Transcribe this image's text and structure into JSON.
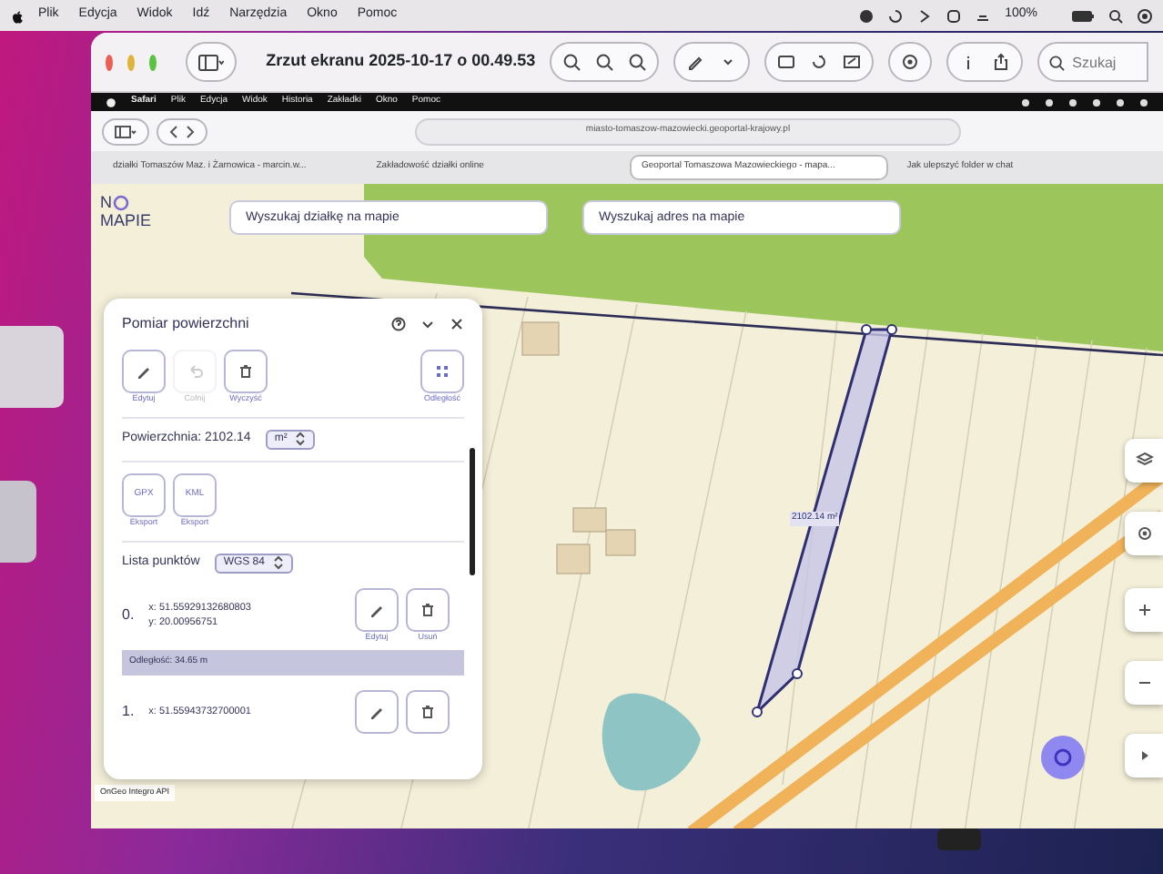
{
  "menu_bar": {
    "items": [
      "Plik",
      "Edycja",
      "Widok",
      "Idź",
      "Narzędzia",
      "Okno",
      "Pomoc"
    ],
    "battery": "100%"
  },
  "preview_window": {
    "title": "Zrzut ekranu 2025-10-17 o 00.49.53",
    "search": {
      "placeholder": "Szukaj"
    }
  },
  "safari": {
    "menu": [
      "Safari",
      "Plik",
      "Edycja",
      "Widok",
      "Historia",
      "Zakładki",
      "Okno",
      "Pomoc"
    ],
    "url": "miasto-tomaszow-mazowiecki.geoportal-krajowy.pl",
    "tabs": [
      {
        "label": "działki Tomaszów Maz. i Żarnowica - marcin.w...",
        "selected": false
      },
      {
        "label": "Zakładowość działki online",
        "selected": false
      },
      {
        "label": "Geoportal Tomaszowa Mazowieckiego - mapa...",
        "selected": true
      },
      {
        "label": "Jak ulepszyć folder w chat",
        "selected": false
      }
    ]
  },
  "map": {
    "logo": {
      "line_1": "N",
      "line_2": "MAPIE"
    },
    "search_fields": [
      {
        "placeholder": "Wyszukaj działkę na mapie"
      },
      {
        "placeholder": "Wyszukaj adres na mapie"
      }
    ],
    "area_label": "2102.14 m²",
    "attribution": "OnGeo Integro API"
  },
  "panel": {
    "title": "Pomiar powierzchni",
    "tools": [
      {
        "label": "Edytuj",
        "disabled": false
      },
      {
        "label": "Cofnij",
        "disabled": true
      },
      {
        "label": "Wyczyść",
        "disabled": false
      },
      {
        "label": "Odległość",
        "disabled": false
      }
    ],
    "area": {
      "label": "Powierzchnia: 2102.14",
      "unit": "m²"
    },
    "exports": [
      {
        "format": "GPX",
        "label": "Eksport"
      },
      {
        "format": "KML",
        "label": "Eksport"
      }
    ],
    "points_title": "Lista punktów",
    "crs": "WGS 84",
    "points": [
      {
        "number": "0.",
        "x": "x: 51.55929132680803",
        "y": "y: 20.00956751",
        "actions": [
          "Edytuj",
          "Usuń"
        ],
        "distance": "Odległość: 34.65 m"
      },
      {
        "number": "1.",
        "x": "x: 51.55943732700001"
      }
    ]
  }
}
